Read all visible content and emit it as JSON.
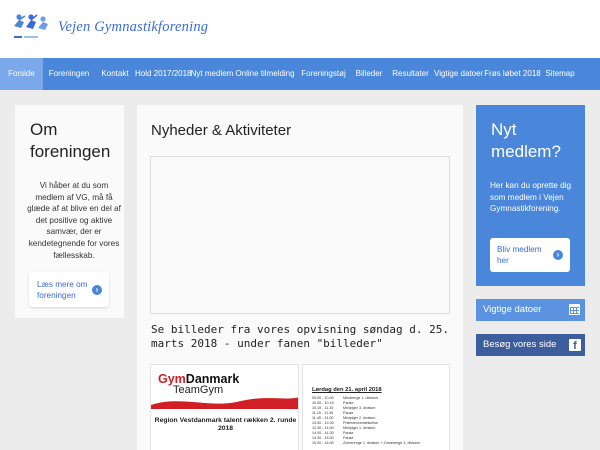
{
  "header": {
    "brand": "Vejen Gymnastikforening",
    "logo_icon": "gymnasts-logo-icon"
  },
  "nav": {
    "items": [
      {
        "label": "Forside",
        "active": true
      },
      {
        "label": "Foreningen"
      },
      {
        "label": "Kontakt"
      },
      {
        "label": "Hold 2017/2018"
      },
      {
        "label": "Nyt medlem"
      },
      {
        "label": "Online tilmelding"
      },
      {
        "label": "Foreningstøj"
      },
      {
        "label": "Billeder"
      },
      {
        "label": "Resultater"
      },
      {
        "label": "Vigtige datoer"
      },
      {
        "label": "Frøs løbet 2018"
      },
      {
        "label": "Sitemap"
      }
    ]
  },
  "about": {
    "title": "Om foreningen",
    "text": "Vi håber at du som medlem af VG, må få glæde af at blive en del af det positive og aktive samvær, der er kendetegnende for vores fællesskab.",
    "button_label": "Læs mere om foreningen"
  },
  "news": {
    "title": "Nyheder & Aktiviteter",
    "notice": "Se billeder fra vores opvisning søndag d. 25. marts 2018 - under fanen \"billeder\"",
    "thumb1": {
      "gym": "Gym",
      "danmark": "Danmark",
      "teamgym": "TeamGym",
      "region": "Region Vestdanmark talent rækken 2. runde 2018"
    },
    "thumb2": {
      "heading": "Lørdag den 21. april 2018",
      "rows": [
        {
          "time": "09.00 - 10.00",
          "text": "Mindrenge 1. division"
        },
        {
          "time": "10.00 - 10.15",
          "text": "Pause"
        },
        {
          "time": "10.15 - 11.15",
          "text": "Minipiger 3. division"
        },
        {
          "time": "11.15 - 11.45",
          "text": "Pause"
        },
        {
          "time": "11.45 - 13.00",
          "text": "Minipiger 2. division"
        },
        {
          "time": "13.00 - 13.30",
          "text": "Præmieoverrækkelse"
        },
        {
          "time": "13.30 - 14.00",
          "text": "Minipiger 1. division"
        },
        {
          "time": "14.00 - 14.30",
          "text": "Pause"
        },
        {
          "time": "14.30 - 15.00",
          "text": "Pause"
        },
        {
          "time": "15.00 - 16.00",
          "text": "Zumerenge 1. division + Zumerenge 3. division"
        }
      ]
    }
  },
  "new_member": {
    "title": "Nyt medlem?",
    "text": "Her kan du oprette dig som medlem i Vejen Gymnastikforening.",
    "button_label": "Bliv medlem her"
  },
  "sidebar_buttons": {
    "dates_label": "Vigtige datoer",
    "dates_icon": "calendar-icon",
    "facebook_label": "Besøg vores side",
    "facebook_icon": "facebook-icon"
  },
  "colors": {
    "primary": "#4a87da",
    "nav_active": "#7aa8ea",
    "facebook": "#3c5e9d",
    "brand_text": "#3a6bd6",
    "gym_red": "#d01f25"
  }
}
